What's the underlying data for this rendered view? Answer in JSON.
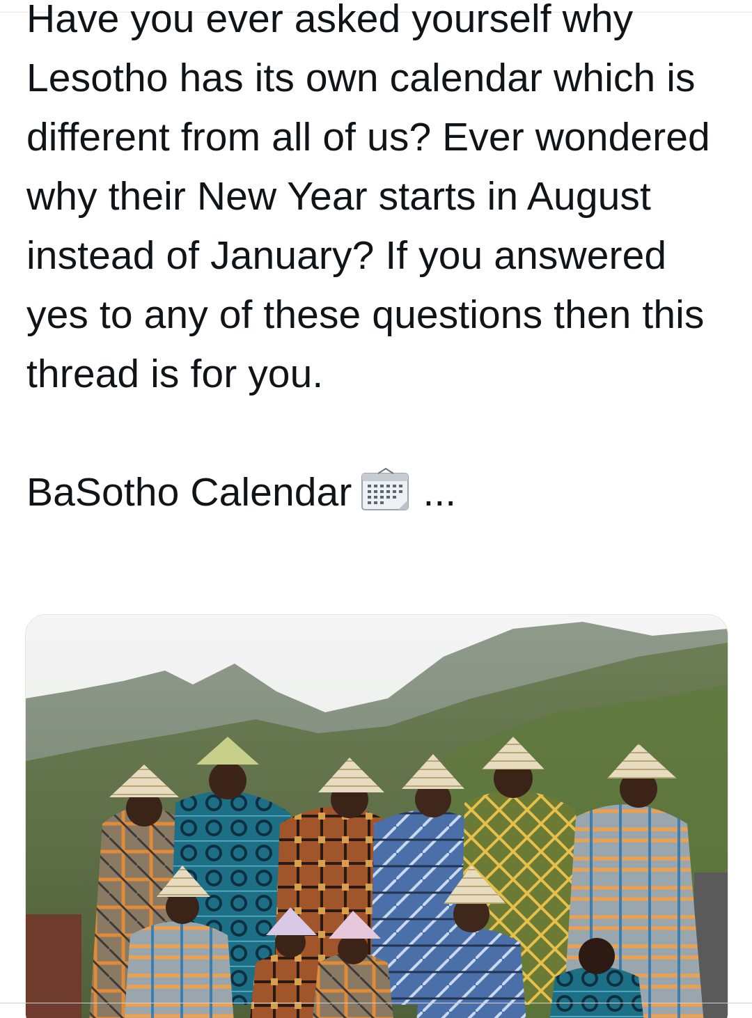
{
  "tweet": {
    "paragraph_1": "Have you ever asked yourself why Lesotho has its own calendar which is different from all of us? Ever wondered why their New Year starts in August instead of January? If you answered yes to any of these questions then this thread is for you.",
    "paragraph_2": "BaSotho Calendar",
    "truncation": "...",
    "emoji_icon": "calendar-icon"
  },
  "media": {
    "icon": "photo-group-basotho-blankets"
  }
}
